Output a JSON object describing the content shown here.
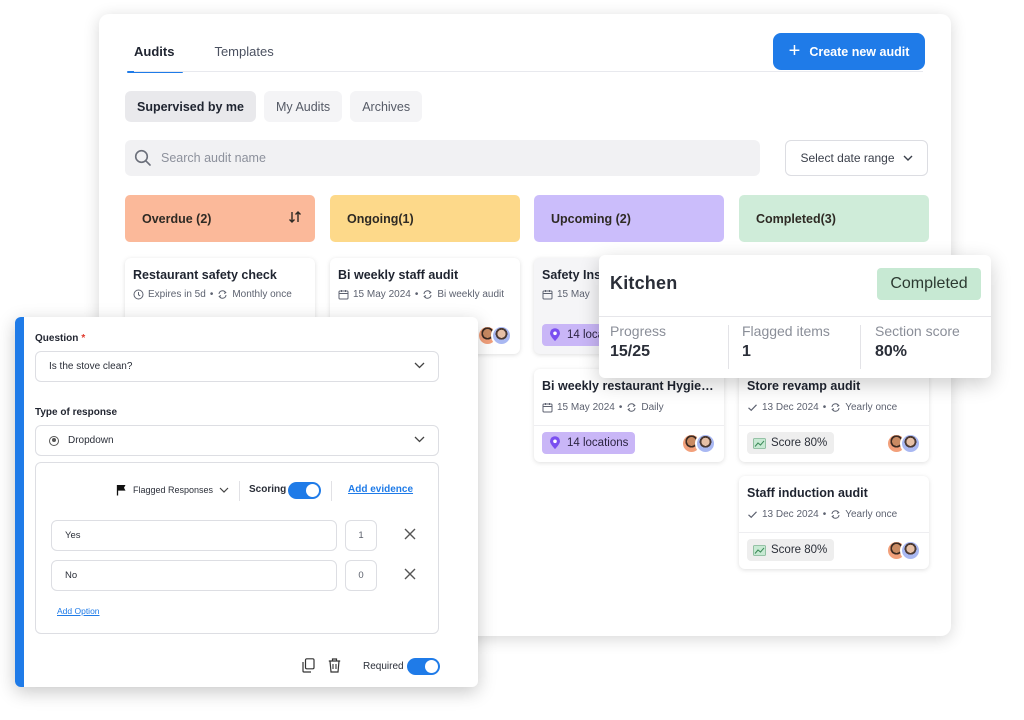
{
  "tabs": [
    {
      "label": "Audits",
      "active": true
    },
    {
      "label": "Templates",
      "active": false
    }
  ],
  "create_button": {
    "label": "Create new audit",
    "icon": "plus-icon"
  },
  "filters": [
    {
      "label": "Supervised by me",
      "active": true
    },
    {
      "label": "My Audits",
      "active": false
    },
    {
      "label": "Archives",
      "active": false
    }
  ],
  "search": {
    "placeholder": "Search audit name",
    "icon": "search-icon"
  },
  "date_range": {
    "label": "Select date range"
  },
  "columns": [
    {
      "label": "Overdue (2)",
      "color": "#fbb99a"
    },
    {
      "label": "Ongoing(1)",
      "color": "#fdd98a"
    },
    {
      "label": "Upcoming (2)",
      "color": "#cbbdfb"
    },
    {
      "label": "Completed(3)",
      "color": "#cfecd9"
    }
  ],
  "cards": {
    "overdue_1": {
      "title": "Restaurant safety check",
      "meta_expiry": "Expires in 5d",
      "meta_repeat": "Monthly once"
    },
    "ongoing_1": {
      "title": "Bi weekly staff audit",
      "meta_date": "15 May 2024",
      "meta_repeat": "Bi weekly audit"
    },
    "upcoming_1": {
      "title": "Safety Insp",
      "meta_date": "15 May",
      "locations": "14 loca"
    },
    "upcoming_2": {
      "title": "Bi weekly restaurant Hygiene l...",
      "meta_date": "15 May 2024",
      "meta_repeat": "Daily",
      "locations": "14 locations"
    },
    "completed_1": {
      "title": "Store revamp audit",
      "meta_date": "13 Dec 2024",
      "meta_repeat": "Yearly once",
      "score": "Score 80%"
    },
    "completed_2": {
      "title": "Staff induction audit",
      "meta_date": "13 Dec 2024",
      "meta_repeat": "Yearly once",
      "score": "Score 80%"
    }
  },
  "kitchen": {
    "title": "Kitchen",
    "status": "Completed",
    "stats": [
      {
        "label": "Progress",
        "value": "15/25"
      },
      {
        "label": "Flagged items",
        "value": "1"
      },
      {
        "label": "Section score",
        "value": "80%"
      }
    ]
  },
  "question_panel": {
    "question_label": "Question",
    "required_mark": "*",
    "question_value": "Is the stove clean?",
    "response_label": "Type of response",
    "response_value": "Dropdown",
    "flagged_label": "Flagged Responses",
    "scoring_label": "Scoring",
    "scoring_on": true,
    "add_evidence": "Add evidence",
    "options": [
      {
        "label": "Yes",
        "score": "1"
      },
      {
        "label": "No",
        "score": "0"
      }
    ],
    "add_option": "Add Option",
    "required_label": "Required",
    "required_on": true
  },
  "accent_color": "#1f7be8"
}
